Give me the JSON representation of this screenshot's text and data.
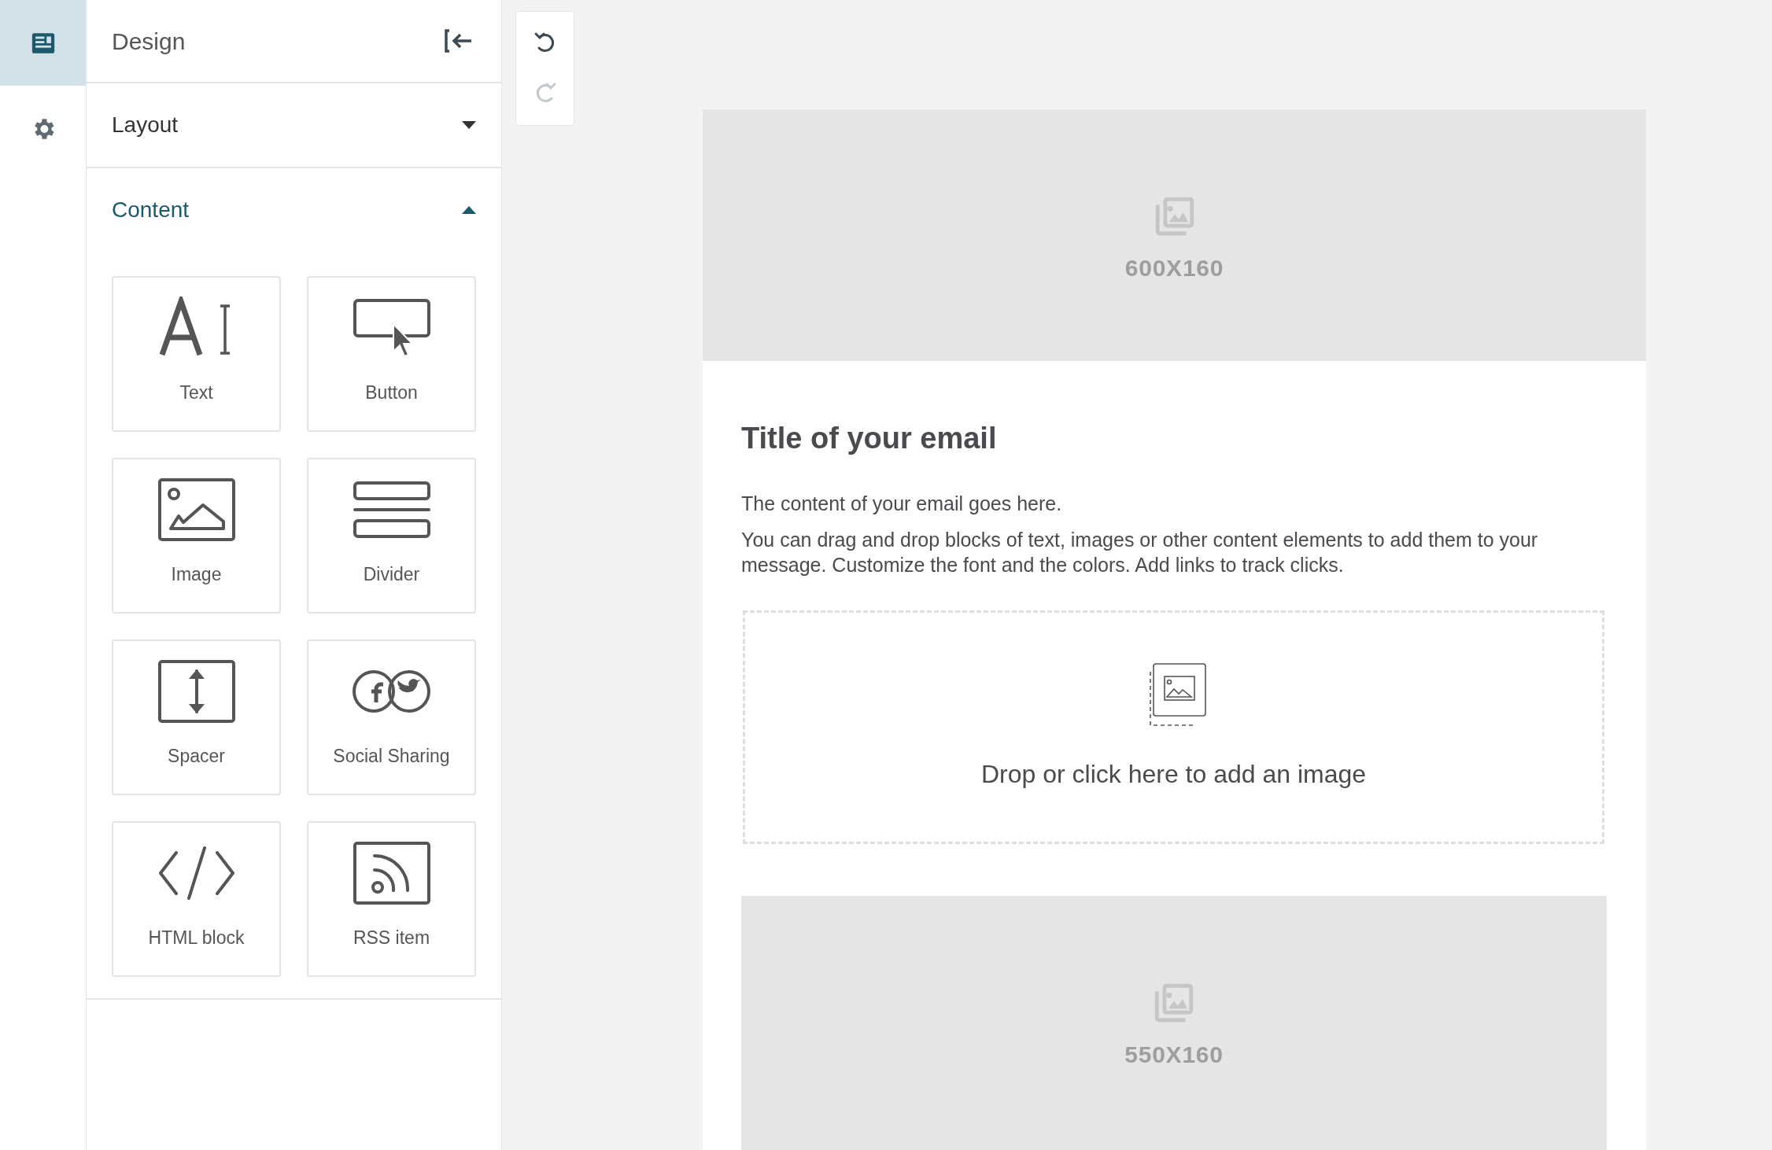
{
  "rail": [
    {
      "kind": "design",
      "selected": true
    },
    {
      "kind": "settings",
      "selected": false
    }
  ],
  "panel": {
    "title": "Design",
    "sections": [
      {
        "title": "Layout",
        "expanded": false
      },
      {
        "title": "Content",
        "expanded": true,
        "blocks": [
          {
            "kind": "text",
            "label": "Text"
          },
          {
            "kind": "button",
            "label": "Button"
          },
          {
            "kind": "image",
            "label": "Image"
          },
          {
            "kind": "divider",
            "label": "Divider"
          },
          {
            "kind": "spacer",
            "label": "Spacer"
          },
          {
            "kind": "social",
            "label": "Social Sharing"
          },
          {
            "kind": "html",
            "label": "HTML block"
          },
          {
            "kind": "rss",
            "label": "RSS item"
          }
        ]
      }
    ]
  },
  "history": {
    "undo_disabled": false,
    "redo_disabled": true
  },
  "email": {
    "header_image": "600X160",
    "title": "Title of your email",
    "paragraphs": [
      "The content of your email goes here.",
      "You can drag and drop blocks of text, images or other content elements to add them to your message. Customize the font and the colors. Add links to track clicks."
    ],
    "drop_zone": "Drop or click here to add an image",
    "footer_image": "550X160"
  }
}
